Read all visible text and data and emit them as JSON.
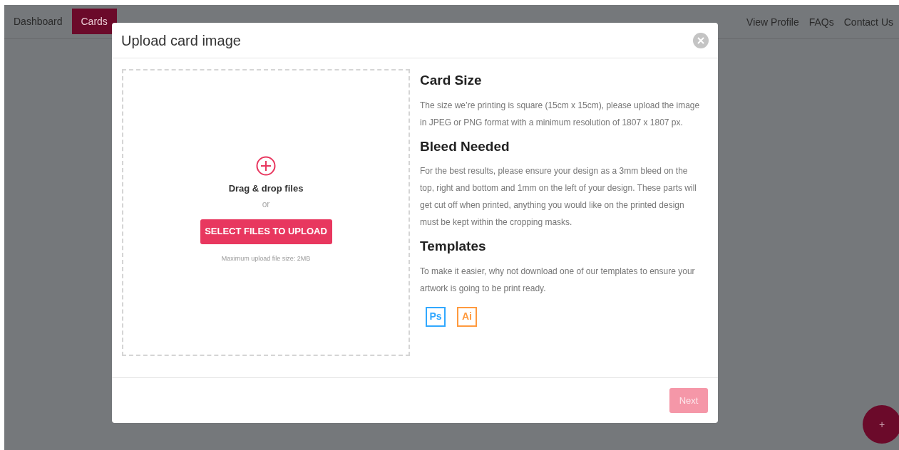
{
  "nav": {
    "left": [
      {
        "label": "Dashboard",
        "selected": false
      },
      {
        "label": "Cards",
        "selected": true
      }
    ],
    "right": [
      "View Profile",
      "FAQs",
      "Contact Us"
    ]
  },
  "modal": {
    "title": "Upload card image",
    "dropzone": {
      "title": "Drag & drop files",
      "or": "or",
      "button": "SELECT FILES TO UPLOAD",
      "note": "Maximum upload file size: 2MB"
    },
    "sections": [
      {
        "heading": "Card Size",
        "text": "The size we’re printing is square (15cm x 15cm), please upload the image in JPEG or PNG format with a minimum resolution of 1807 x 1807 px."
      },
      {
        "heading": "Bleed Needed",
        "text": "For the best results, please ensure your design as a 3mm bleed on the top, right and bottom and 1mm on the left of your design. These parts will get cut off when printed, anything you would like on the printed design must be kept within the cropping masks."
      },
      {
        "heading": "Templates",
        "text": "To make it easier, why not download one of our templates to ensure your artwork is going to be print ready."
      }
    ],
    "templates": [
      {
        "label": "Ps",
        "color": "#31a8ff"
      },
      {
        "label": "Ai",
        "color": "#ff9a3e"
      }
    ],
    "next": {
      "label": "Next",
      "disabled": true
    }
  },
  "fab": "+"
}
